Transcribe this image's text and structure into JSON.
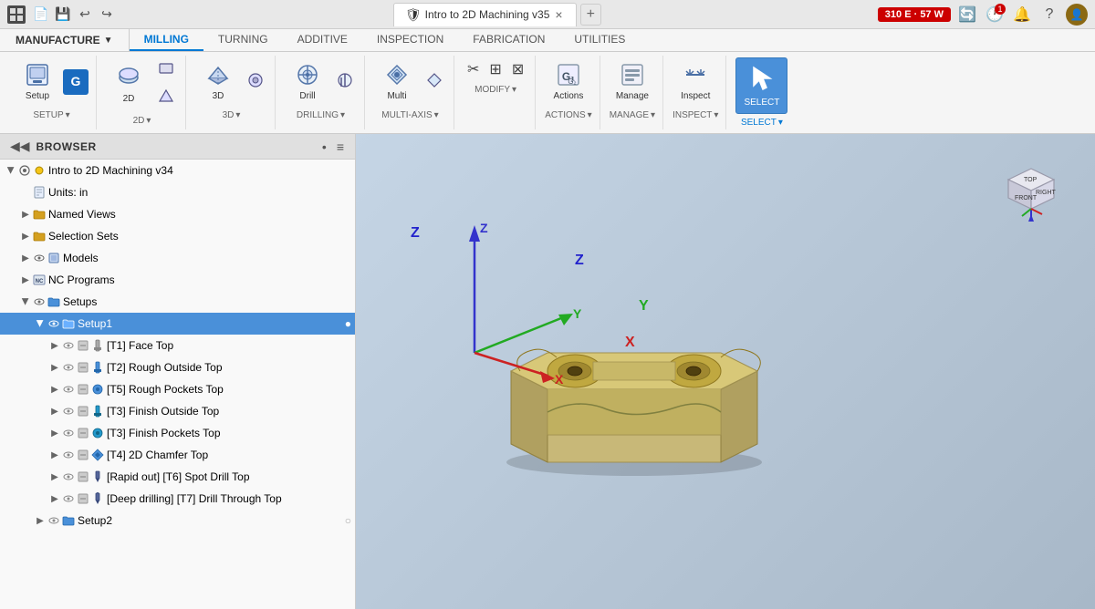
{
  "titleBar": {
    "appIcon": "⚙",
    "tabTitle": "Intro to 2D Machining v35",
    "tabIcon": "🛡",
    "closeTab": "×",
    "addTab": "+",
    "badge": "310 E · 57 W",
    "icons": [
      "🔄",
      "🕐",
      "🔔",
      "?"
    ],
    "clockBadge": "1"
  },
  "ribbon": {
    "tabs": [
      "MILLING",
      "TURNING",
      "ADDITIVE",
      "INSPECTION",
      "FABRICATION",
      "UTILITIES"
    ],
    "activeTab": "MILLING",
    "manufacture": "MANUFACTURE",
    "groups": [
      {
        "name": "SETUP",
        "buttons": [
          {
            "label": "Setup",
            "icon": "📋"
          },
          {
            "label": "G",
            "icon": "G",
            "special": true
          }
        ]
      },
      {
        "name": "2D",
        "buttons": [
          {
            "label": "2D",
            "icon": "◈"
          },
          {
            "label": "",
            "icon": "◆"
          },
          {
            "label": "",
            "icon": "▣"
          }
        ]
      },
      {
        "name": "3D",
        "buttons": [
          {
            "label": "3D",
            "icon": "◉"
          },
          {
            "label": "",
            "icon": "⊕"
          }
        ]
      },
      {
        "name": "DRILLING",
        "buttons": [
          {
            "label": "Drill",
            "icon": "⊙"
          },
          {
            "label": "",
            "icon": "⊗"
          }
        ]
      },
      {
        "name": "MULTI-AXIS",
        "buttons": [
          {
            "label": "",
            "icon": "✦"
          },
          {
            "label": "",
            "icon": "✧"
          }
        ]
      },
      {
        "name": "MODIFY",
        "buttons": [
          {
            "label": "",
            "icon": "✂"
          },
          {
            "label": "",
            "icon": "⊞"
          },
          {
            "label": "",
            "icon": "⊠"
          }
        ]
      },
      {
        "name": "ACTIONS",
        "buttons": [
          {
            "label": "",
            "icon": "▶"
          },
          {
            "label": "",
            "icon": "G₂"
          }
        ]
      },
      {
        "name": "MANAGE",
        "buttons": [
          {
            "label": "",
            "icon": "⧉"
          },
          {
            "label": "",
            "icon": "⊟"
          }
        ]
      },
      {
        "name": "INSPECT",
        "buttons": [
          {
            "label": "",
            "icon": "↔"
          }
        ]
      },
      {
        "name": "SELECT",
        "buttons": [
          {
            "label": "",
            "icon": "↖",
            "active": true
          }
        ]
      }
    ]
  },
  "browser": {
    "title": "BROWSER",
    "collapseIcon": "◀",
    "dotIcon": "•",
    "linesIcon": "≡",
    "root": {
      "label": "Intro to 2D Machining v34",
      "expanded": true,
      "children": [
        {
          "label": "Units: in",
          "type": "file",
          "indent": 1
        },
        {
          "label": "Named Views",
          "type": "folder",
          "indent": 1,
          "expandable": true
        },
        {
          "label": "Selection Sets",
          "type": "folder",
          "indent": 1,
          "expandable": true
        },
        {
          "label": "Models",
          "type": "component",
          "indent": 1,
          "expandable": true,
          "hasEye": true
        },
        {
          "label": "NC Programs",
          "type": "ncprog",
          "indent": 1,
          "expandable": true
        },
        {
          "label": "Setups",
          "type": "setups",
          "indent": 1,
          "expandable": true,
          "hasEye": true,
          "expanded": true,
          "children": [
            {
              "label": "Setup1",
              "type": "setup",
              "indent": 2,
              "selected": true,
              "hasEye": true,
              "hasStatus": true,
              "statusIcon": "●",
              "children": [
                {
                  "label": "[T1] Face Top",
                  "type": "op",
                  "indent": 3,
                  "color": "gray",
                  "hasEye": true
                },
                {
                  "label": "[T2] Rough Outside Top",
                  "type": "op",
                  "indent": 3,
                  "color": "blue",
                  "hasEye": true
                },
                {
                  "label": "[T5] Rough Pockets Top",
                  "type": "op",
                  "indent": 3,
                  "color": "blue",
                  "hasEye": true
                },
                {
                  "label": "[T3] Finish Outside Top",
                  "type": "op",
                  "indent": 3,
                  "color": "cyan",
                  "hasEye": true
                },
                {
                  "label": "[T3] Finish Pockets Top",
                  "type": "op",
                  "indent": 3,
                  "color": "cyan",
                  "hasEye": true
                },
                {
                  "label": "[T4] 2D Chamfer Top",
                  "type": "op",
                  "indent": 3,
                  "color": "blue",
                  "hasEye": true
                },
                {
                  "label": "[Rapid out] [T6] Spot Drill Top",
                  "type": "op",
                  "indent": 3,
                  "color": "darkblue",
                  "hasEye": true
                },
                {
                  "label": "[Deep drilling] [T7] Drill Through Top",
                  "type": "op",
                  "indent": 3,
                  "color": "darkblue",
                  "hasEye": true
                }
              ]
            },
            {
              "label": "Setup2",
              "type": "setup",
              "indent": 2,
              "hasEye": true,
              "hasStatus": true,
              "statusIcon": "○"
            }
          ]
        }
      ]
    }
  },
  "viewport": {
    "axes": {
      "z": "Z",
      "y": "Y",
      "x": "X"
    },
    "cubeLabels": [
      "FRONT",
      "RIGHT"
    ]
  }
}
